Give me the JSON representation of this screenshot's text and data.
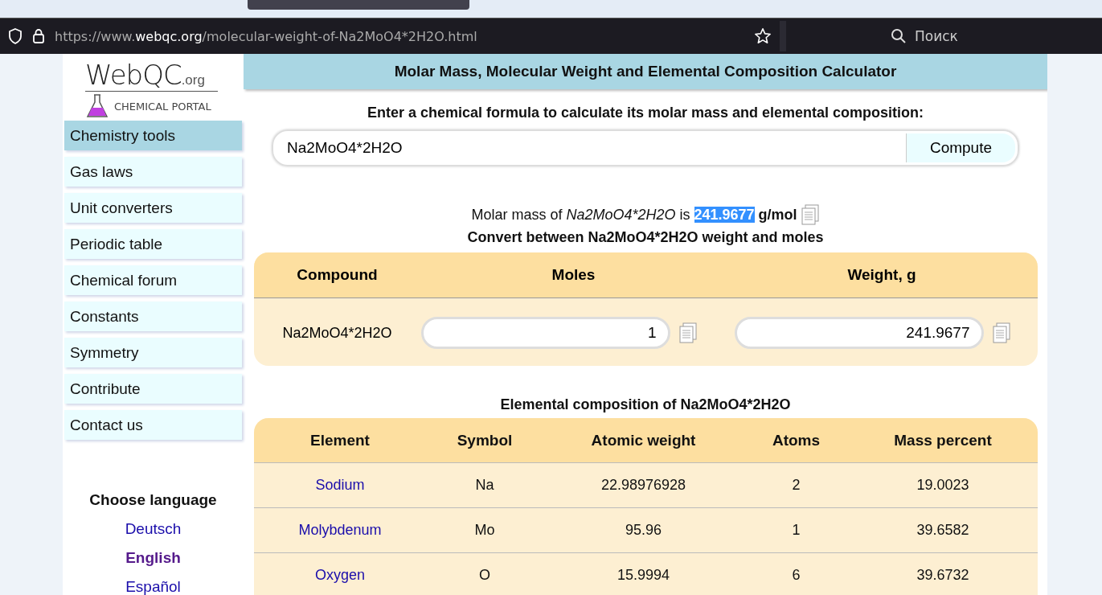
{
  "browser": {
    "url_host": "https://www.",
    "url_domain": "webqc.org",
    "url_path": "/molecular-weight-of-Na2MoO4*2H2O.html",
    "search_placeholder": "Поиск"
  },
  "logo": {
    "name": "WebQC",
    "suffix": ".org",
    "tagline": "CHEMICAL PORTAL"
  },
  "sidebar": {
    "items": [
      {
        "label": "Chemistry tools",
        "selected": true
      },
      {
        "label": "Gas laws",
        "selected": false
      },
      {
        "label": "Unit converters",
        "selected": false
      },
      {
        "label": "Periodic table",
        "selected": false
      },
      {
        "label": "Chemical forum",
        "selected": false
      },
      {
        "label": "Constants",
        "selected": false
      },
      {
        "label": "Symmetry",
        "selected": false
      },
      {
        "label": "Contribute",
        "selected": false
      },
      {
        "label": "Contact us",
        "selected": false
      }
    ],
    "language_title": "Choose language",
    "languages": [
      {
        "label": "Deutsch",
        "selected": false
      },
      {
        "label": "English",
        "selected": true
      },
      {
        "label": "Español",
        "selected": false
      }
    ]
  },
  "main": {
    "title": "Molar Mass, Molecular Weight and Elemental Composition Calculator",
    "prompt": "Enter a chemical formula to calculate its molar mass and elemental composition:",
    "formula_input": "Na2MoO4*2H2O",
    "compute_button": "Compute",
    "result": {
      "prefix": "Molar mass of",
      "formula": "Na2MoO4*2H2O",
      "is": "is",
      "value": "241.9677",
      "value_highlighted": true,
      "unit": "g/mol"
    },
    "convert_title": "Convert between Na2MoO4*2H2O weight and moles",
    "convert_table": {
      "columns": [
        "Compound",
        "Moles",
        "Weight, g"
      ],
      "compound": "Na2MoO4*2H2O",
      "moles": "1",
      "weight": "241.9677"
    },
    "composition_title": "Elemental composition of Na2MoO4*2H2O",
    "composition_table": {
      "columns": [
        "Element",
        "Symbol",
        "Atomic weight",
        "Atoms",
        "Mass percent"
      ],
      "rows": [
        [
          "Sodium",
          "Na",
          "22.98976928",
          "2",
          "19.0023"
        ],
        [
          "Molybdenum",
          "Mo",
          "95.96",
          "1",
          "39.6582"
        ],
        [
          "Oxygen",
          "O",
          "15.9994",
          "6",
          "39.6732"
        ]
      ]
    }
  }
}
